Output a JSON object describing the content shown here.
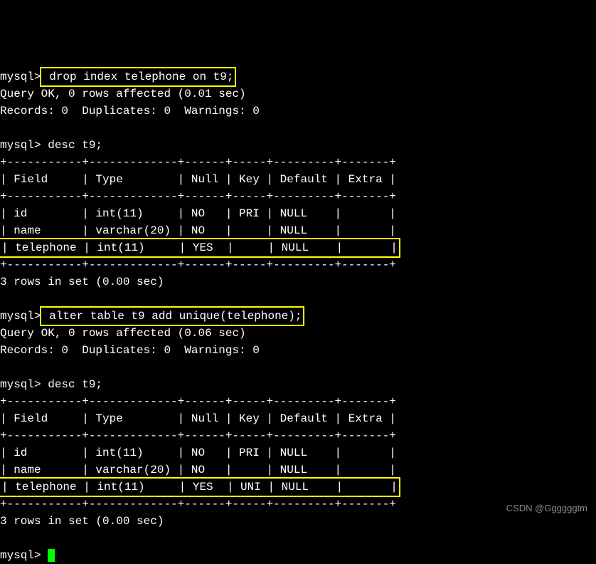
{
  "prompt": "mysql>",
  "cmd1": " drop index telephone on t9;",
  "result1_line1": "Query OK, 0 rows affected (0.01 sec)",
  "result1_line2": "Records: 0  Duplicates: 0  Warnings: 0",
  "cmd2": " desc t9;",
  "table1": {
    "border": "+-----------+-------------+------+-----+---------+-------+",
    "header": "| Field     | Type        | Null | Key | Default | Extra |",
    "row1": "| id        | int(11)     | NO   | PRI | NULL    |       |",
    "row2": "| name      | varchar(20) | NO   |     | NULL    |       |",
    "row3": "| telephone | int(11)     | YES  |     | NULL    |       |"
  },
  "result2": "3 rows in set (0.00 sec)",
  "cmd3": " alter table t9 add unique(telephone);",
  "result3_line1": "Query OK, 0 rows affected (0.06 sec)",
  "result3_line2": "Records: 0  Duplicates: 0  Warnings: 0",
  "cmd4": " desc t9;",
  "table2": {
    "border": "+-----------+-------------+------+-----+---------+-------+",
    "header": "| Field     | Type        | Null | Key | Default | Extra |",
    "row1": "| id        | int(11)     | NO   | PRI | NULL    |       |",
    "row2": "| name      | varchar(20) | NO   |     | NULL    |       |",
    "row3": "| telephone | int(11)     | YES  | UNI | NULL    |       |"
  },
  "result4": "3 rows in set (0.00 sec)",
  "watermark": "CSDN @Ggggggtm"
}
